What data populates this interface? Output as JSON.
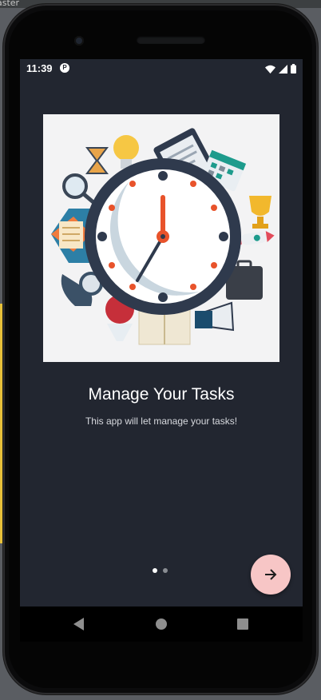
{
  "ide": {
    "tab_fragment": "aster"
  },
  "status_bar": {
    "time": "11:39",
    "app_icon_letter": "P",
    "icons": [
      "wifi-icon",
      "signal-icon",
      "battery-icon"
    ]
  },
  "onboarding": {
    "title": "Manage Your Tasks",
    "subtitle": "This app will let manage your tasks!",
    "illustration": "clock-tasks-illustration",
    "page_indicator": {
      "total": 2,
      "active": 1
    },
    "next_button_icon": "arrow-forward-icon"
  },
  "navigation": {
    "buttons": [
      "back-icon",
      "home-icon",
      "recents-icon"
    ]
  },
  "colors": {
    "screen_bg": "#222630",
    "fab_bg": "#f7c6c6",
    "clock_accent": "#e8532b",
    "clock_frame": "#2f3a4d"
  }
}
